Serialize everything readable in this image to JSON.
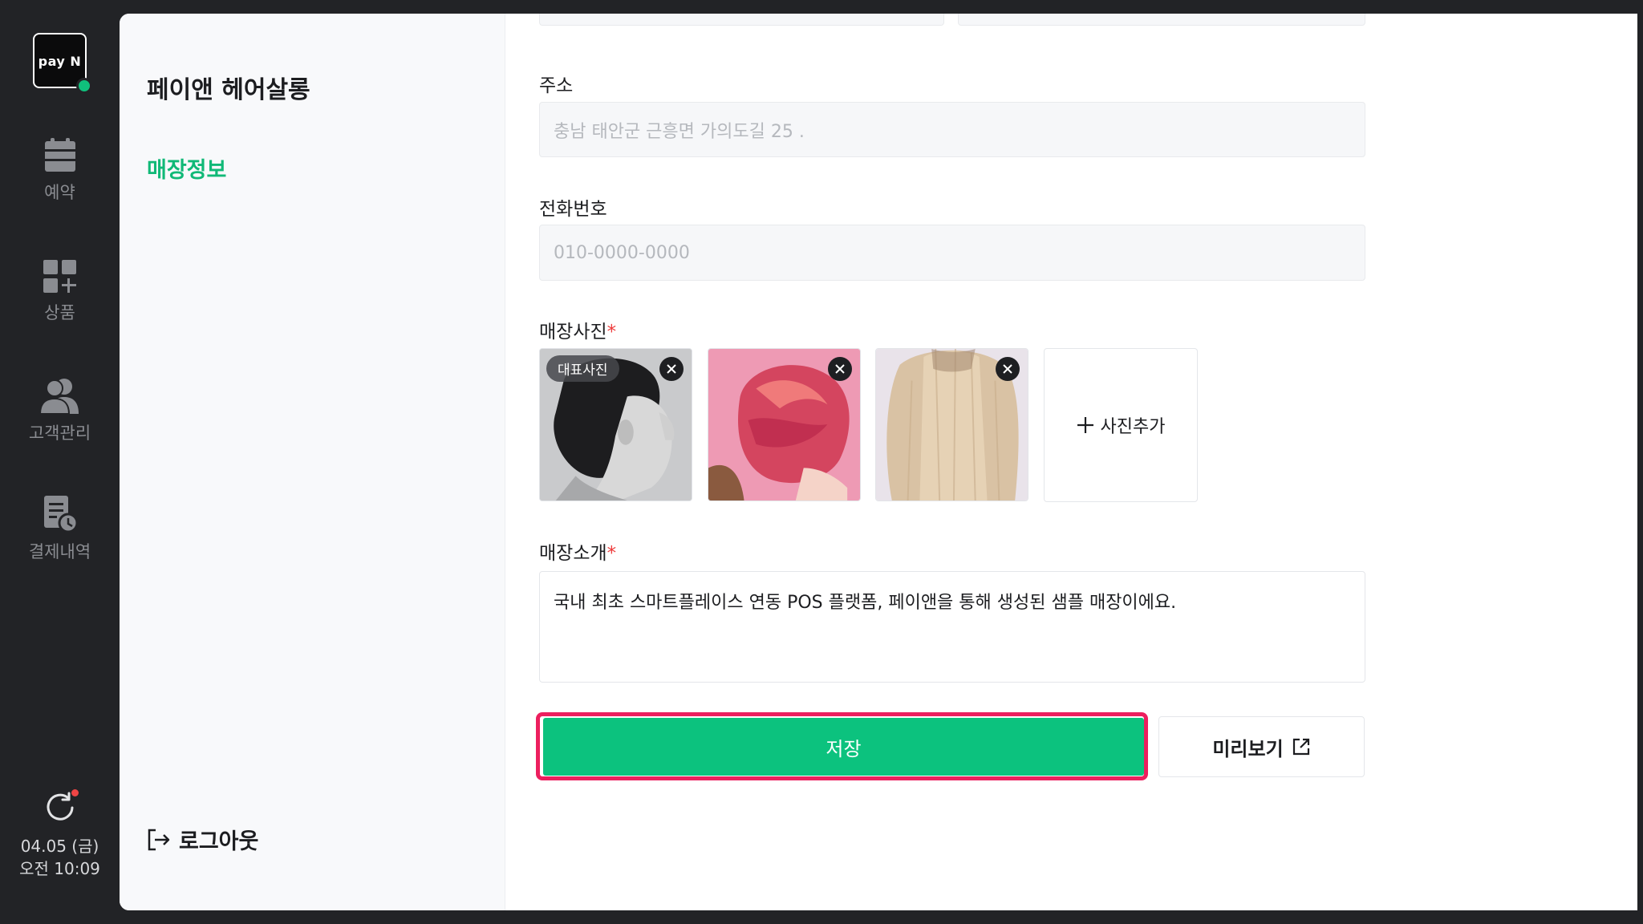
{
  "brand": {
    "logo_text": "pay N",
    "accent": "#0cc27e",
    "status_dot": "#10c07c"
  },
  "rail": {
    "items": [
      {
        "label": "예약",
        "icon": "calendar-icon"
      },
      {
        "label": "상품",
        "icon": "grid-plus-icon"
      },
      {
        "label": "고객관리",
        "icon": "users-icon"
      },
      {
        "label": "결제내역",
        "icon": "receipt-clock-icon"
      }
    ],
    "refresh_icon": "refresh-icon",
    "date": "04.05 (금)",
    "time": "오전 10:09"
  },
  "subnav": {
    "shop_name": "페이앤 헤어살롱",
    "active_item": "매장정보",
    "logout_label": "로그아웃"
  },
  "form": {
    "address": {
      "label": "주소",
      "placeholder": "충남 태안군 근흥면 가의도길 25 ."
    },
    "phone": {
      "label": "전화번호",
      "placeholder": "010-0000-0000"
    },
    "photos": {
      "label": "매장사진",
      "required_mark": "*",
      "main_badge": "대표사진",
      "add_label": "사진추가"
    },
    "intro": {
      "label": "매장소개",
      "required_mark": "*",
      "value": "국내 최초 스마트플레이스 연동 POS 플랫폼, 페이앤을 통해 생성된 샘플 매장이에요."
    },
    "save_label": "저장",
    "preview_label": "미리보기"
  }
}
